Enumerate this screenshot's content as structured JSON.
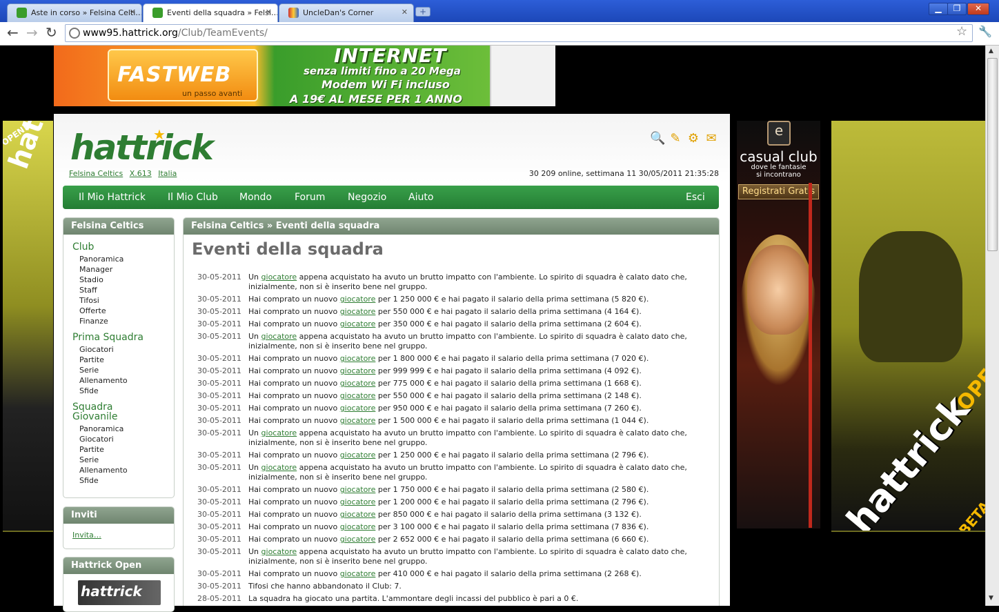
{
  "browser": {
    "tabs": [
      {
        "title": "Aste in corso » Felsina Celti…",
        "active": false
      },
      {
        "title": "Eventi della squadra » Felsi…",
        "active": true
      },
      {
        "title": "UncleDan's Corner",
        "active": false
      }
    ],
    "url_host": "www95.hattrick.org",
    "url_path": "/Club/TeamEvents/"
  },
  "ads": {
    "top_brand": "FASTWEB",
    "top_brand_tagline": "un passo avanti",
    "top_headline": "INTERNET",
    "top_lines": [
      "senza limiti fino a 20 Mega",
      "Modem Wi Fi incluso",
      "A 19€ AL MESE PER 1 ANNO"
    ],
    "left_skin_badge": "OPEN!",
    "left_skin_logo": "hattrick",
    "right_brand": "casual club",
    "right_tagline": [
      "dove le fantasie",
      "si incontrano"
    ],
    "right_button": "Registrati Gratis",
    "skin_logo": "hattrick",
    "skin_open": "OPEN",
    "skin_beta": "BETA"
  },
  "header": {
    "logo": "hattrick",
    "breadcrumbs": [
      "Felsina Celtics",
      "X.613",
      "Italia"
    ],
    "status": "30 209 online, settimana 11  30/05/2011 21:35:28"
  },
  "menu": [
    "Il Mio Hattrick",
    "Il Mio Club",
    "Mondo",
    "Forum",
    "Negozio",
    "Aiuto"
  ],
  "menu_logout": "Esci",
  "sidebar": {
    "title": "Felsina Celtics",
    "groups": [
      {
        "label": "Club",
        "items": [
          "Panoramica",
          "Manager",
          "Stadio",
          "Staff",
          "Tifosi",
          "Offerte",
          "Finanze"
        ]
      },
      {
        "label": "Prima Squadra",
        "items": [
          "Giocatori",
          "Partite",
          "Serie",
          "Allenamento",
          "Sfide"
        ]
      },
      {
        "label": "Squadra Giovanile",
        "items": [
          "Panoramica",
          "Giocatori",
          "Partite",
          "Serie",
          "Allenamento",
          "Sfide"
        ]
      }
    ],
    "invite_title": "Inviti",
    "invite_link": "Invita…",
    "open_title": "Hattrick Open",
    "open_image_text": "hattrick"
  },
  "main": {
    "breadcrumb": "Felsina Celtics  »  Eventi della squadra",
    "title": "Eventi della squadra",
    "link_word": "giocatore",
    "events": [
      {
        "date": "30-05-2011",
        "pre": "Un ",
        "post": " appena acquistato ha avuto un brutto impatto con l'ambiente. Lo spirito di squadra è calato dato che, inizialmente, non si è inserito bene nel gruppo."
      },
      {
        "date": "30-05-2011",
        "pre": "Hai comprato un nuovo ",
        "post": " per 1 250 000 € e hai pagato il salario della prima settimana (5 820 €)."
      },
      {
        "date": "30-05-2011",
        "pre": "Hai comprato un nuovo ",
        "post": " per 550 000 € e hai pagato il salario della prima settimana (4 164 €)."
      },
      {
        "date": "30-05-2011",
        "pre": "Hai comprato un nuovo ",
        "post": " per 350 000 € e hai pagato il salario della prima settimana (2 604 €)."
      },
      {
        "date": "30-05-2011",
        "pre": "Un ",
        "post": " appena acquistato ha avuto un brutto impatto con l'ambiente. Lo spirito di squadra è calato dato che, inizialmente, non si è inserito bene nel gruppo."
      },
      {
        "date": "30-05-2011",
        "pre": "Hai comprato un nuovo ",
        "post": " per 1 800 000 € e hai pagato il salario della prima settimana (7 020 €)."
      },
      {
        "date": "30-05-2011",
        "pre": "Hai comprato un nuovo ",
        "post": " per 999 999 € e hai pagato il salario della prima settimana (4 092 €)."
      },
      {
        "date": "30-05-2011",
        "pre": "Hai comprato un nuovo ",
        "post": " per 775 000 € e hai pagato il salario della prima settimana (1 668 €)."
      },
      {
        "date": "30-05-2011",
        "pre": "Hai comprato un nuovo ",
        "post": " per 550 000 € e hai pagato il salario della prima settimana (2 148 €)."
      },
      {
        "date": "30-05-2011",
        "pre": "Hai comprato un nuovo ",
        "post": " per 950 000 € e hai pagato il salario della prima settimana (7 260 €)."
      },
      {
        "date": "30-05-2011",
        "pre": "Hai comprato un nuovo ",
        "post": " per 1 500 000 € e hai pagato il salario della prima settimana (1 044 €)."
      },
      {
        "date": "30-05-2011",
        "pre": "Un ",
        "post": " appena acquistato ha avuto un brutto impatto con l'ambiente. Lo spirito di squadra è calato dato che, inizialmente, non si è inserito bene nel gruppo."
      },
      {
        "date": "30-05-2011",
        "pre": "Hai comprato un nuovo ",
        "post": " per 1 250 000 € e hai pagato il salario della prima settimana (2 796 €)."
      },
      {
        "date": "30-05-2011",
        "pre": "Un ",
        "post": " appena acquistato ha avuto un brutto impatto con l'ambiente. Lo spirito di squadra è calato dato che, inizialmente, non si è inserito bene nel gruppo."
      },
      {
        "date": "30-05-2011",
        "pre": "Hai comprato un nuovo ",
        "post": " per 1 750 000 € e hai pagato il salario della prima settimana (2 580 €)."
      },
      {
        "date": "30-05-2011",
        "pre": "Hai comprato un nuovo ",
        "post": " per 1 200 000 € e hai pagato il salario della prima settimana (2 796 €)."
      },
      {
        "date": "30-05-2011",
        "pre": "Hai comprato un nuovo ",
        "post": " per 850 000 € e hai pagato il salario della prima settimana (3 132 €)."
      },
      {
        "date": "30-05-2011",
        "pre": "Hai comprato un nuovo ",
        "post": " per 3 100 000 € e hai pagato il salario della prima settimana (7 836 €)."
      },
      {
        "date": "30-05-2011",
        "pre": "Hai comprato un nuovo ",
        "post": " per 2 652 000 € e hai pagato il salario della prima settimana (6 660 €)."
      },
      {
        "date": "30-05-2011",
        "pre": "Un ",
        "post": " appena acquistato ha avuto un brutto impatto con l'ambiente. Lo spirito di squadra è calato dato che, inizialmente, non si è inserito bene nel gruppo."
      },
      {
        "date": "30-05-2011",
        "pre": "Hai comprato un nuovo ",
        "post": " per 410 000 € e hai pagato il salario della prima settimana (2 268 €)."
      },
      {
        "date": "30-05-2011",
        "pre": "Tifosi che hanno abbandonato il Club: 7.",
        "post": ""
      },
      {
        "date": "28-05-2011",
        "pre": "La squadra ha giocato una partita. L'ammontare degli incassi del pubblico è pari a 0 €.",
        "post": ""
      }
    ]
  }
}
